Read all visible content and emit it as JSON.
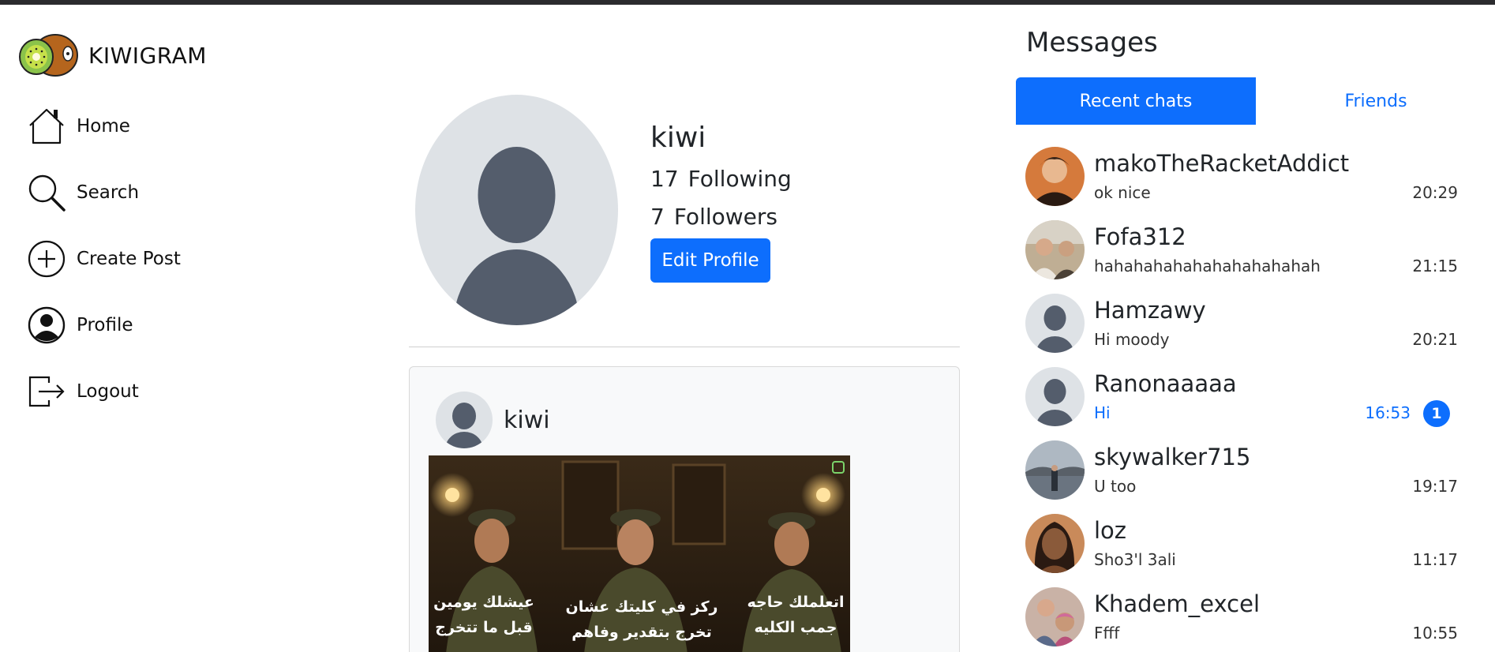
{
  "app": {
    "brand": "KIWIGRAM"
  },
  "sidebar": {
    "items": [
      {
        "label": "Home",
        "icon": "home-icon"
      },
      {
        "label": "Search",
        "icon": "search-icon"
      },
      {
        "label": "Create Post",
        "icon": "plus-circle-icon"
      },
      {
        "label": "Profile",
        "icon": "user-circle-icon"
      },
      {
        "label": "Logout",
        "icon": "logout-icon"
      }
    ]
  },
  "profile": {
    "username": "kiwi",
    "following_count": "17",
    "following_label": "Following",
    "followers_count": "7",
    "followers_label": "Followers",
    "edit_button": "Edit Profile"
  },
  "post": {
    "username": "kiwi",
    "image_captions": [
      "عيشلك يومين قبل ما تتخرج",
      "ركز في كليتك عشان تخرج بتقدير وفاهم",
      "اتعلملك حاجه جمب الكليه"
    ]
  },
  "messages": {
    "title": "Messages",
    "tabs": [
      {
        "label": "Recent chats",
        "active": true
      },
      {
        "label": "Friends",
        "active": false
      }
    ],
    "chats": [
      {
        "name": "makoTheRacketAddict",
        "message": "ok nice",
        "time": "20:29",
        "avatar_color": "#c4683a",
        "unread": 0
      },
      {
        "name": "Fofa312",
        "message": "hahahahahahahahahahahah",
        "time": "21:15",
        "avatar_color": "#b8a58c",
        "unread": 0
      },
      {
        "name": "Hamzawy",
        "message": "Hi moody",
        "time": "20:21",
        "avatar_color": "#dee2e6",
        "unread": 0
      },
      {
        "name": "Ranonaaaaa",
        "message": "Hi",
        "time": "16:53",
        "avatar_color": "#dee2e6",
        "unread": "1"
      },
      {
        "name": "skywalker715",
        "message": "U too",
        "time": "19:17",
        "avatar_color": "#8b95a0",
        "unread": 0
      },
      {
        "name": "loz",
        "message": "Sho3'l 3ali",
        "time": "11:17",
        "avatar_color": "#8a5a3a",
        "unread": 0
      },
      {
        "name": "Khadem_excel",
        "message": "Ffff",
        "time": "10:55",
        "avatar_color": "#b46a8c",
        "unread": 0
      }
    ]
  },
  "colors": {
    "accent": "#0d6efd",
    "avatar_bg": "#dee2e6",
    "avatar_fg": "#545d6c"
  }
}
